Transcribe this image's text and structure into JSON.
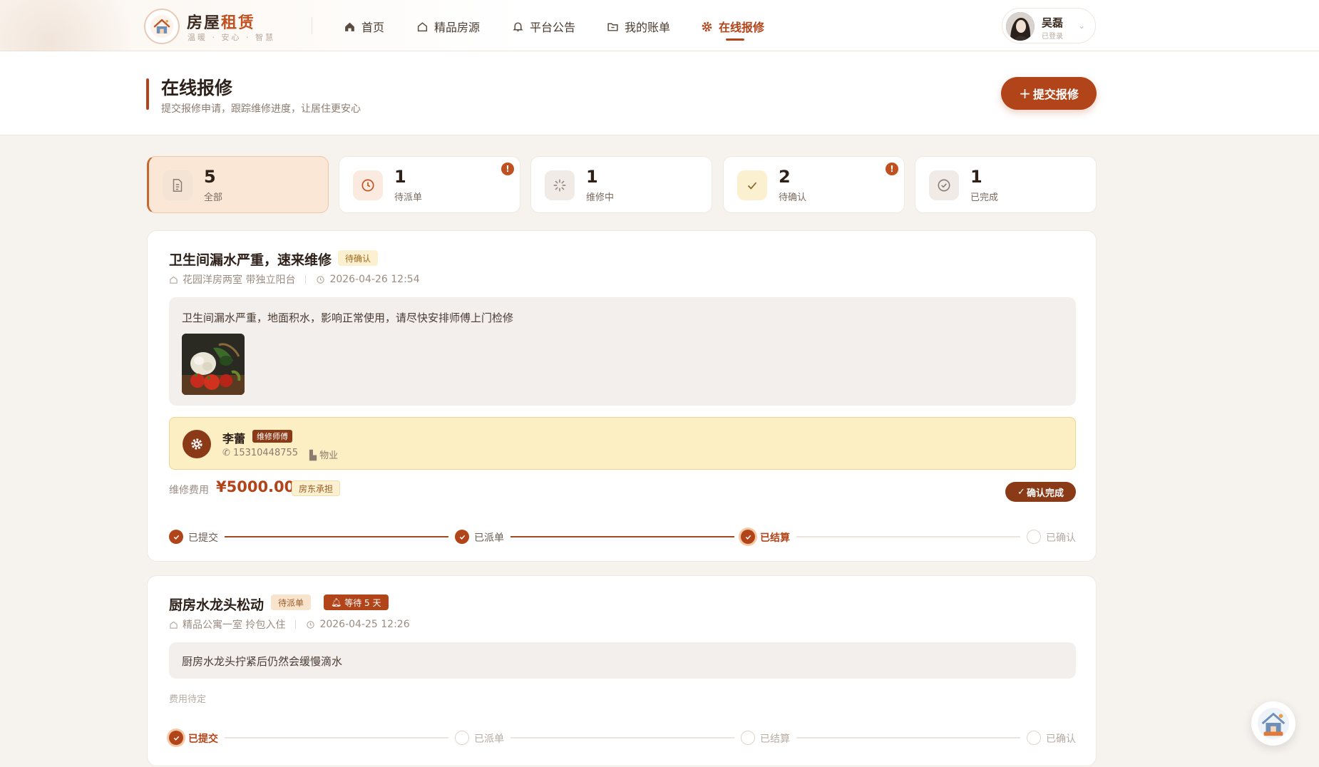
{
  "brand": {
    "title_a": "房屋",
    "title_b": "租赁",
    "subtitle": "温暖 · 安心 · 智慧"
  },
  "nav": [
    {
      "label": "首页",
      "icon": "home-icon"
    },
    {
      "label": "精品房源",
      "icon": "house-icon"
    },
    {
      "label": "平台公告",
      "icon": "bell-icon"
    },
    {
      "label": "我的账单",
      "icon": "folder-icon"
    },
    {
      "label": "在线报修",
      "icon": "gear-icon",
      "active": true
    }
  ],
  "user": {
    "name": "吴磊",
    "status": "已登录"
  },
  "page": {
    "title": "在线报修",
    "subtitle": "提交报修申请，跟踪维修进度，让居住更安心",
    "submit_label": "提交报修"
  },
  "stats": [
    {
      "num": "5",
      "label": "全部",
      "icon": "document-icon",
      "active": true,
      "alert": false
    },
    {
      "num": "1",
      "label": "待派单",
      "icon": "clock-icon",
      "active": false,
      "alert": true
    },
    {
      "num": "1",
      "label": "维修中",
      "icon": "spinner-icon",
      "active": false,
      "alert": false
    },
    {
      "num": "2",
      "label": "待确认",
      "icon": "check-icon",
      "active": false,
      "alert": true
    },
    {
      "num": "1",
      "label": "已完成",
      "icon": "check-circle-icon",
      "active": false,
      "alert": false
    }
  ],
  "alert_mark": "!",
  "orders": [
    {
      "title": "卫生间漏水严重，速来维修",
      "status": "待确认",
      "property": "花园洋房两室 带独立阳台",
      "time": "2026-04-26 12:54",
      "description": "卫生间漏水严重，地面积水，影响正常使用，请尽快安排师傅上门检修",
      "has_image": true,
      "worker": {
        "name": "李蕾",
        "role": "维修师傅",
        "phone": "15310448755",
        "dept": "物业"
      },
      "fee_label": "维修费用",
      "fee": "¥5000.00",
      "fee_payer": "房东承担",
      "action": "确认完成",
      "progress": [
        {
          "label": "已提交",
          "state": "done"
        },
        {
          "label": "已派单",
          "state": "done"
        },
        {
          "label": "已结算",
          "state": "current"
        },
        {
          "label": "已确认",
          "state": "todo"
        }
      ]
    },
    {
      "title": "厨房水龙头松动",
      "status": "待派单",
      "wait_badge": "等待 5 天",
      "property": "精品公寓一室 拎包入住",
      "time": "2026-04-25 12:26",
      "description": "厨房水龙头拧紧后仍然会缓慢滴水",
      "fee_pending": "费用待定",
      "progress": [
        {
          "label": "已提交",
          "state": "current"
        },
        {
          "label": "已派单",
          "state": "todo"
        },
        {
          "label": "已结算",
          "state": "todo"
        },
        {
          "label": "已确认",
          "state": "todo"
        }
      ]
    }
  ],
  "colors": {
    "accent": "#b2441a",
    "accent_dark": "#8b3a17",
    "bg": "#f6f3ef"
  }
}
